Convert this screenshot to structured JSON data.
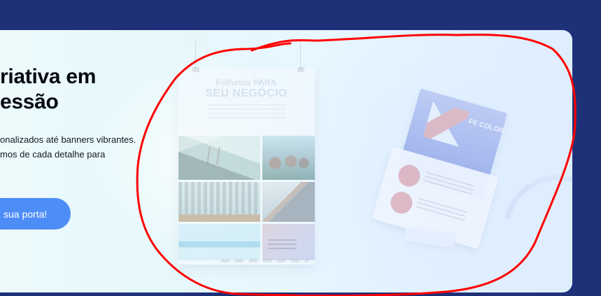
{
  "hero": {
    "title_line_1": "riativa em",
    "title_line_2": "essão",
    "description_line_1": "onalizados até banners vibrantes.",
    "description_line_2": "mos de cada detalhe para",
    "cta_label": "sua porta!"
  },
  "visual": {
    "poster_title_line_1": "Folhetos PARA",
    "poster_title_line_2": "SEU NEGÓCIO",
    "card_brand": "FE COLOR"
  },
  "annotation": {
    "color": "#ff0000"
  }
}
